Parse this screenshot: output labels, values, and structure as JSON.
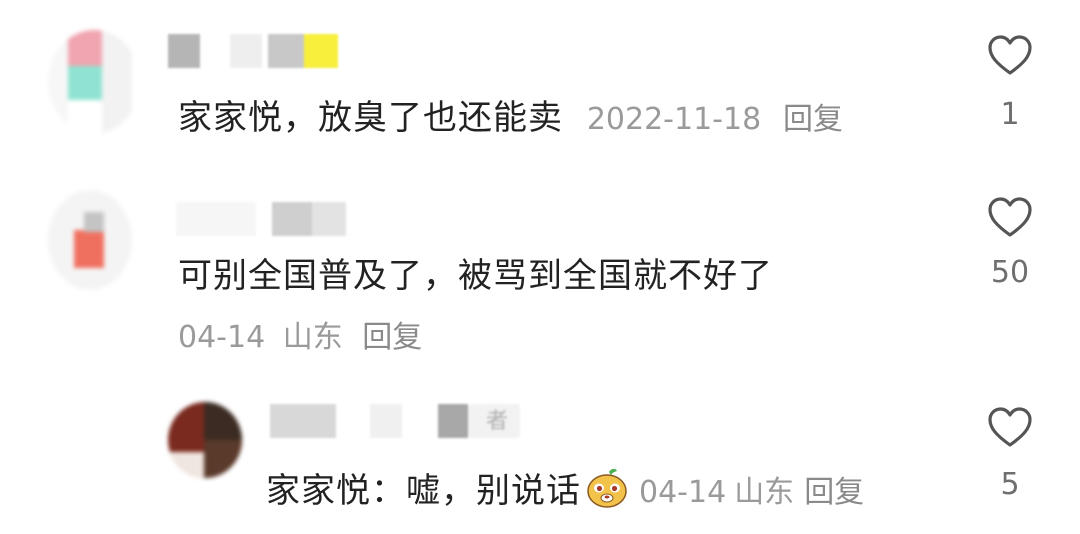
{
  "comments": [
    {
      "text": "家家悦，放臭了也还能卖",
      "date": "2022-11-18",
      "reply_label": "回复",
      "like_count": "1"
    },
    {
      "text": "可别全国普及了，被骂到全国就不好了",
      "date": "04-14",
      "location": "山东",
      "reply_label": "回复",
      "like_count": "50"
    },
    {
      "text": "家家悦：嘘，别说话",
      "emoji": "smiling-face-emoji",
      "date": "04-14",
      "location": "山东",
      "reply_label": "回复",
      "like_count": "5",
      "author_tag": "者"
    }
  ],
  "colors": {
    "text": "#222222",
    "meta": "#9a9a9a",
    "heart_stroke": "#555555"
  }
}
